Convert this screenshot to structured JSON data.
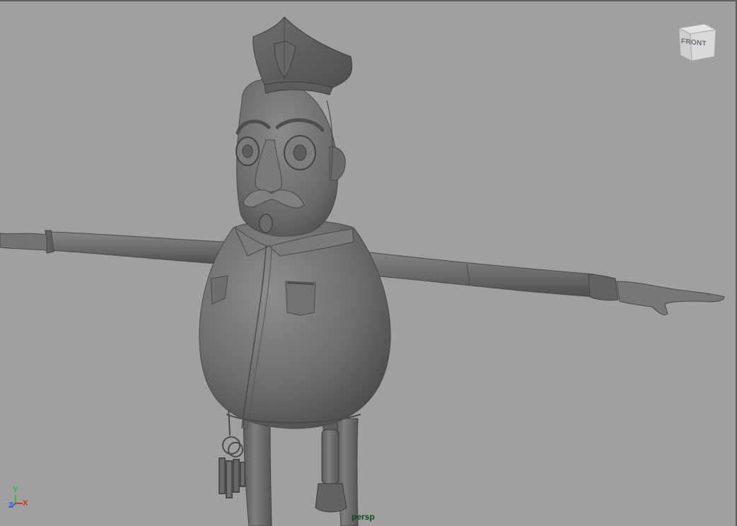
{
  "viewport": {
    "camera_name": "persp",
    "background_color": "#a0a0a0",
    "model_color": "#717171"
  },
  "view_cube": {
    "face_label": "FRONT"
  },
  "axis_gizmo": {
    "y_label": "Y",
    "z_label": "Z",
    "x_label": "X",
    "y_color": "#27c43a",
    "z_color": "#2f62d8",
    "x_color": "#d43028"
  }
}
